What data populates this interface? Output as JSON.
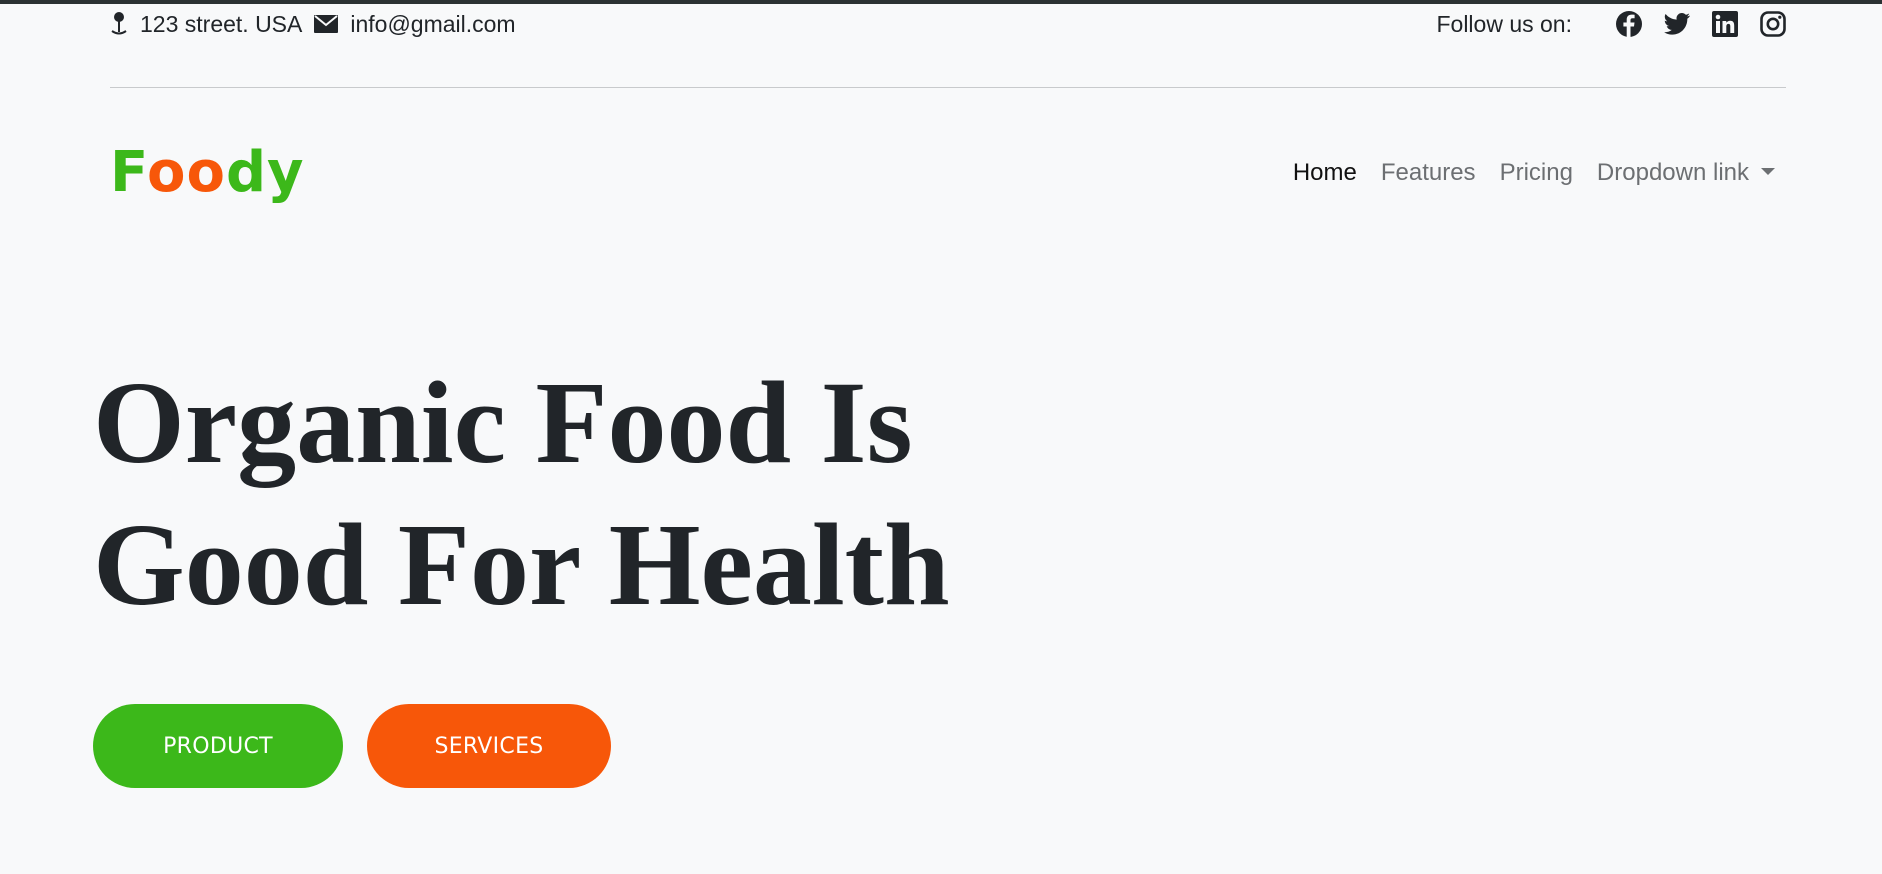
{
  "topbar": {
    "address": "123 street. USA",
    "email": "info@gmail.com",
    "follow_label": "Follow us on:",
    "social_icons": [
      "facebook-icon",
      "twitter-icon",
      "linkedin-icon",
      "instagram-icon"
    ]
  },
  "brand": {
    "letters": [
      "F",
      "o",
      "o",
      "d",
      "y"
    ],
    "colors": {
      "green": "#3cb81a",
      "orange": "#f75709"
    }
  },
  "nav": {
    "items": [
      {
        "label": "Home",
        "active": true
      },
      {
        "label": "Features",
        "active": false
      },
      {
        "label": "Pricing",
        "active": false
      },
      {
        "label": "Dropdown link",
        "active": false,
        "dropdown": true
      }
    ]
  },
  "hero": {
    "title_line1": "Organic Food Is",
    "title_line2": "Good For Health",
    "buttons": {
      "product": "PRODUCT",
      "services": "SERVICES"
    }
  },
  "colors": {
    "background": "#f8f9fa",
    "text": "#212529",
    "accent_green": "#3cb81a",
    "accent_orange": "#f75709"
  }
}
